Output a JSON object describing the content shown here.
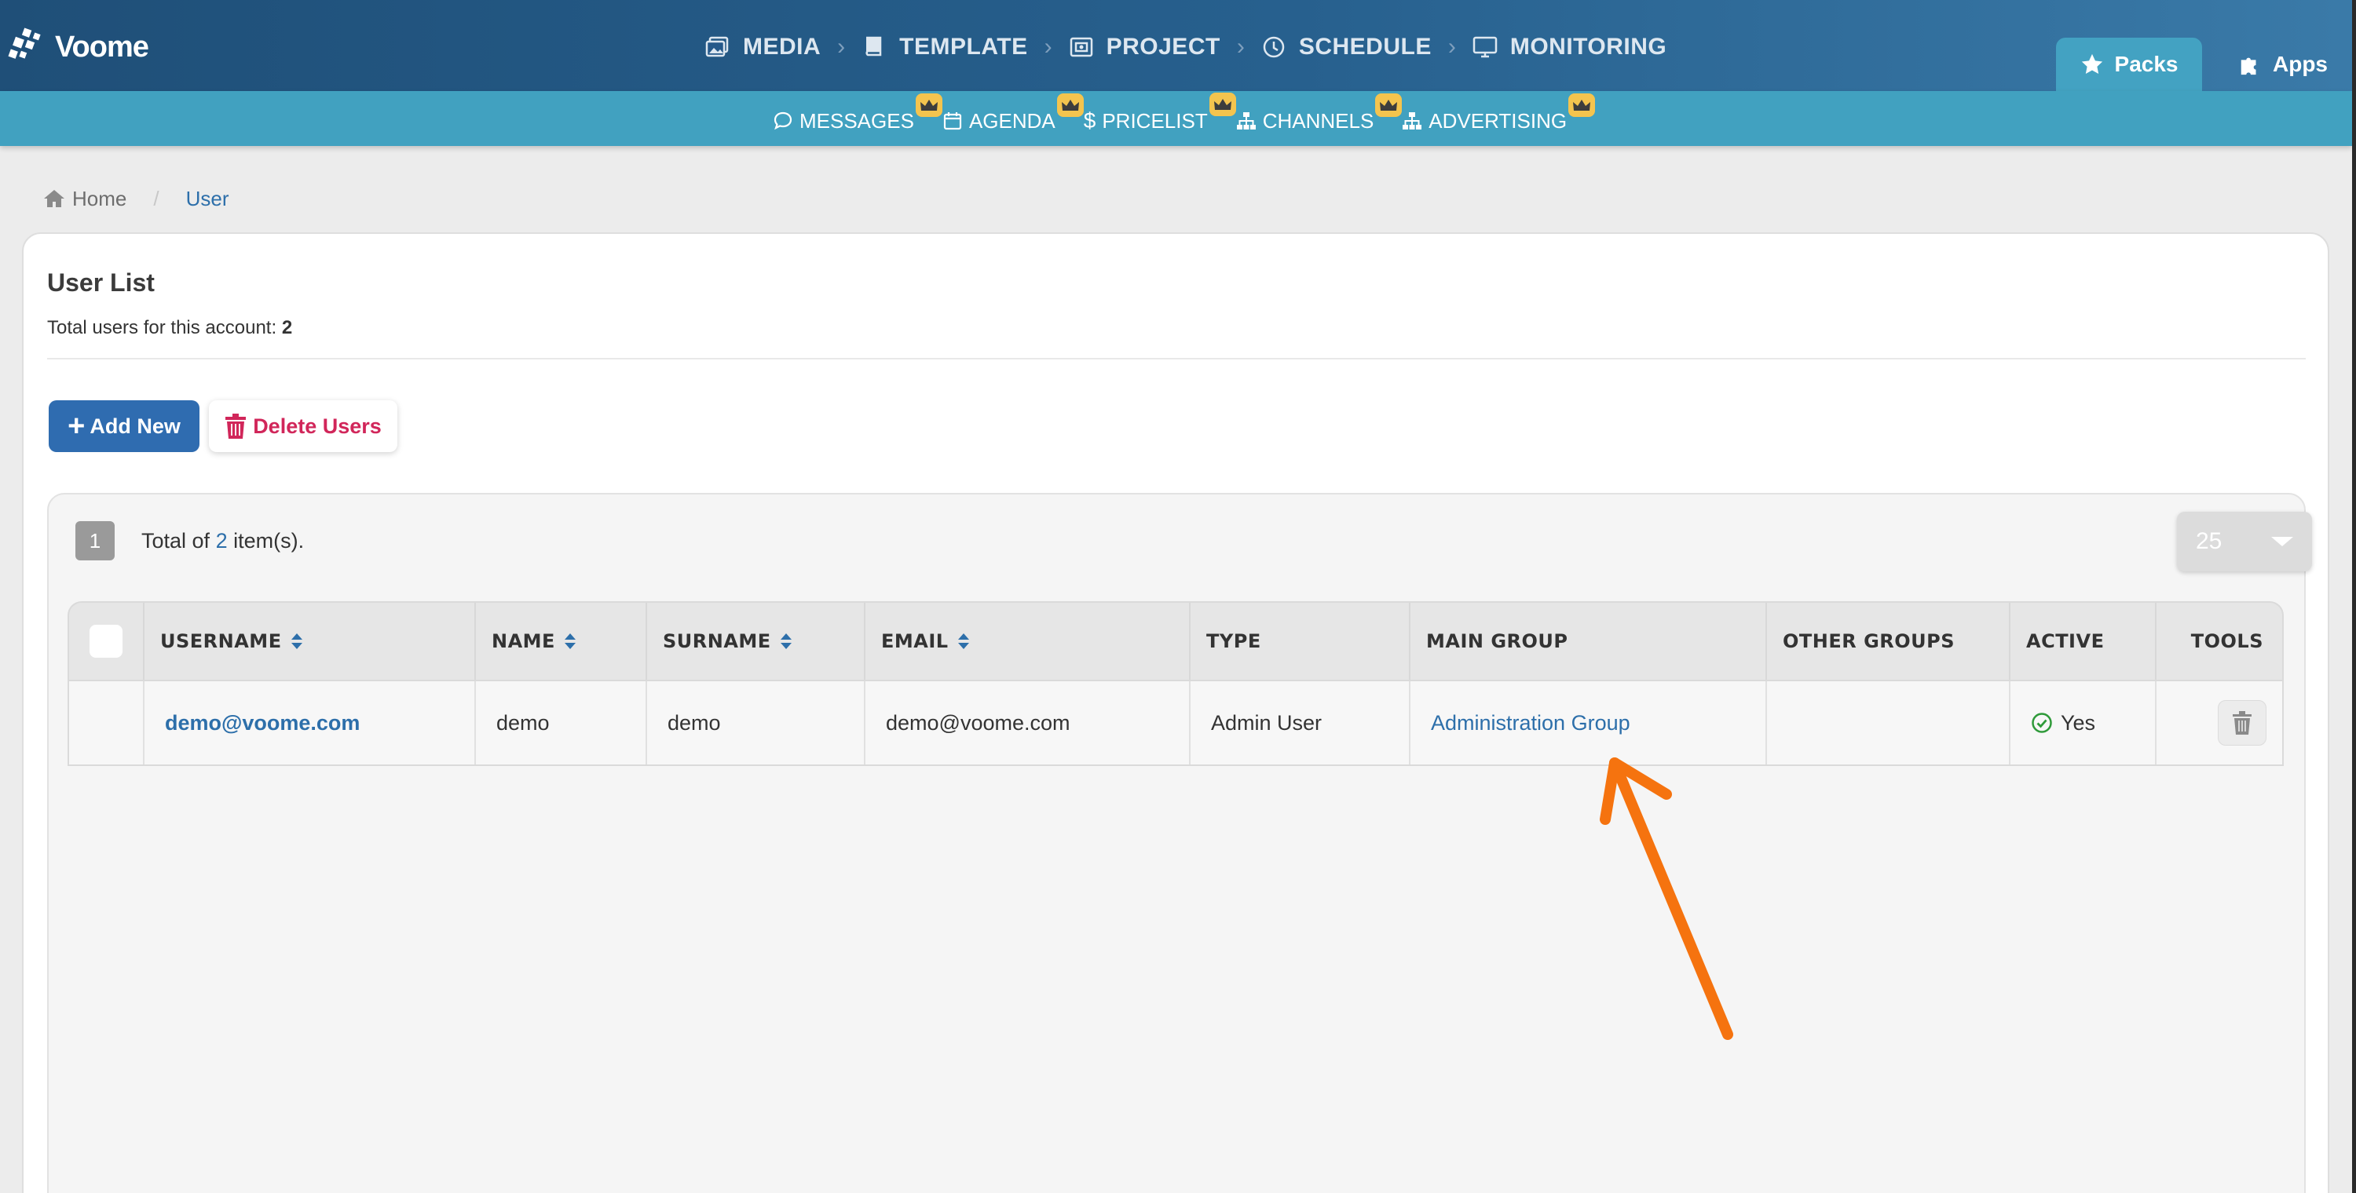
{
  "brand": {
    "name": "Voome"
  },
  "main_nav": [
    {
      "label": "MEDIA",
      "icon": "image-icon"
    },
    {
      "label": "TEMPLATE",
      "icon": "book-icon"
    },
    {
      "label": "PROJECT",
      "icon": "project-icon"
    },
    {
      "label": "SCHEDULE",
      "icon": "clock-icon"
    },
    {
      "label": "MONITORING",
      "icon": "monitor-icon"
    }
  ],
  "tabs": [
    {
      "label": "Packs",
      "icon": "star-icon",
      "active": true
    },
    {
      "label": "Apps",
      "icon": "puzzle-icon",
      "active": false
    }
  ],
  "sub_nav": [
    {
      "label": "MESSAGES",
      "icon": "chat-icon",
      "premium": true
    },
    {
      "label": "AGENDA",
      "icon": "calendar-icon",
      "premium": true
    },
    {
      "label": "PRICELIST",
      "icon": "dollar-icon",
      "premium": true
    },
    {
      "label": "CHANNELS",
      "icon": "sitemap-icon",
      "premium": true
    },
    {
      "label": "ADVERTISING",
      "icon": "sitemap-icon",
      "premium": true
    }
  ],
  "breadcrumb": {
    "home": "Home",
    "current": "User"
  },
  "page": {
    "title": "User List",
    "subtitle_prefix": "Total users for this account: ",
    "subtitle_count": "2",
    "add_button": "Add New",
    "delete_button": "Delete Users"
  },
  "grid": {
    "page_number": "1",
    "total_prefix": "Total of ",
    "total_count": "2",
    "total_suffix": " item(s).",
    "page_size": "25",
    "columns": [
      "USERNAME",
      "NAME",
      "SURNAME",
      "EMAIL",
      "TYPE",
      "MAIN GROUP",
      "OTHER GROUPS",
      "ACTIVE",
      "TOOLS"
    ],
    "rows": [
      {
        "username": "demo@voome.com",
        "name": "demo",
        "surname": "demo",
        "email": "demo@voome.com",
        "type": "Admin User",
        "main_group": "Administration Group",
        "other_groups": "",
        "active": "Yes"
      }
    ]
  },
  "colors": {
    "topbar": "#27608e",
    "subnav": "#41a1c0",
    "link": "#2d6faa",
    "danger": "#d1265a",
    "annotation": "#f5730f",
    "premium_badge": "#f4c44e"
  }
}
